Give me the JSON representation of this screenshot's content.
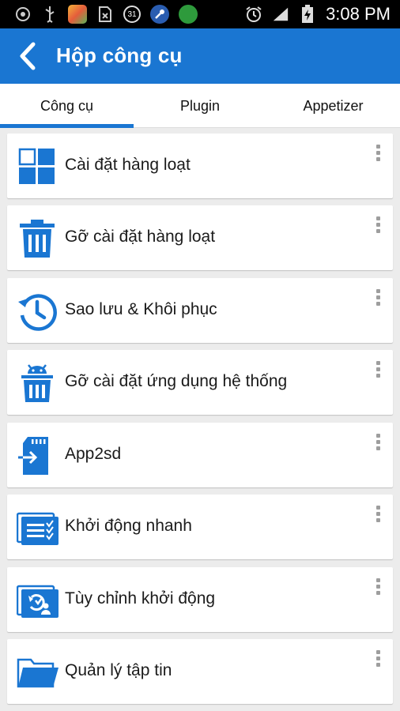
{
  "status_bar": {
    "time": "3:08 PM",
    "calendar_badge": "31",
    "icons": [
      "android-debug-icon",
      "usb-icon",
      "app-icon",
      "sim-icon",
      "calendar-icon",
      "wrench-icon",
      "games-icon",
      "alarm-icon",
      "signal-icon",
      "battery-charging-icon"
    ]
  },
  "app_bar": {
    "title": "Hộp công cụ",
    "back_icon": "back-arrow-icon",
    "color": "#1a76d2"
  },
  "tabs": [
    {
      "label": "Công cụ",
      "selected": true
    },
    {
      "label": "Plugin",
      "selected": false
    },
    {
      "label": "Appetizer",
      "selected": false
    }
  ],
  "tools": [
    {
      "label": "Cài đặt hàng loạt",
      "icon": "batch-install-icon"
    },
    {
      "label": "Gỡ cài đặt hàng loạt",
      "icon": "batch-uninstall-icon"
    },
    {
      "label": "Sao lưu & Khôi phục",
      "icon": "backup-restore-icon"
    },
    {
      "label": "Gỡ cài đặt ứng dụng hệ thống",
      "icon": "system-app-uninstall-icon"
    },
    {
      "label": "App2sd",
      "icon": "app2sd-icon"
    },
    {
      "label": "Khởi động nhanh",
      "icon": "quick-boot-icon"
    },
    {
      "label": "Tùy chỉnh khởi động",
      "icon": "boot-customize-icon"
    },
    {
      "label": "Quản lý tập tin",
      "icon": "file-manager-icon"
    }
  ],
  "colors": {
    "accent": "#1a76d2",
    "background": "#ececec",
    "card": "#ffffff"
  }
}
